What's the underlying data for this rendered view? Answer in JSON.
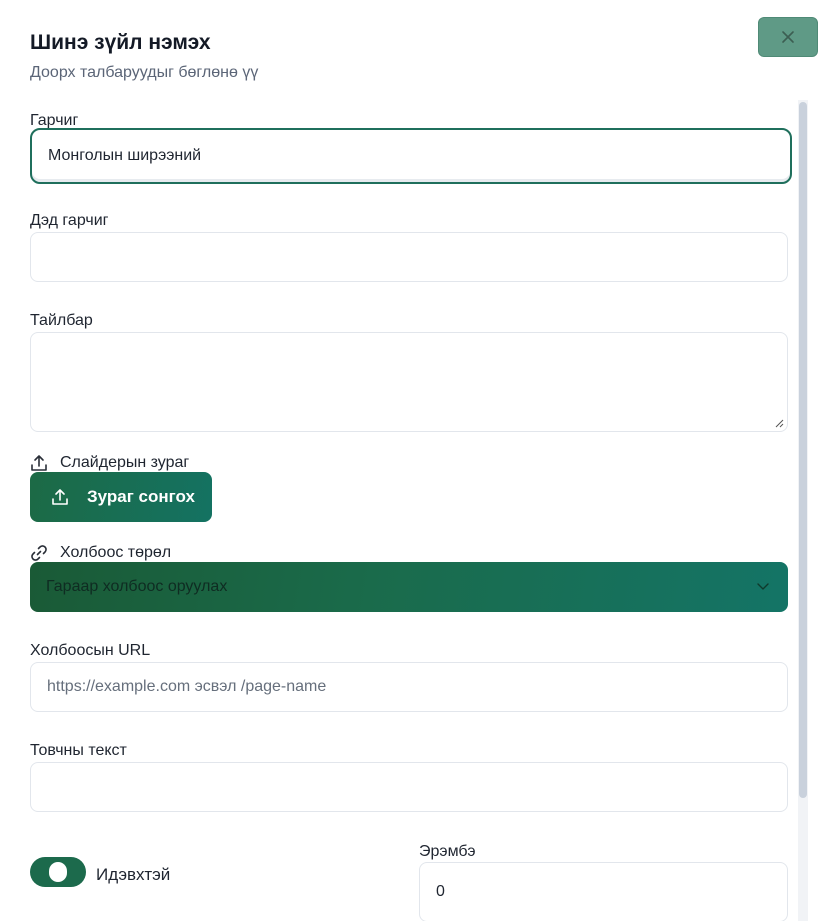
{
  "dialog": {
    "title": "Шинэ зүйл нэмэх",
    "subtitle": "Доорх талбаруудыг бөглөнө үү"
  },
  "fields": {
    "title": {
      "label": "Гарчиг",
      "value": "Монголын ширээний"
    },
    "subtitle": {
      "label": "Дэд гарчиг",
      "value": ""
    },
    "description": {
      "label": "Тайлбар",
      "value": ""
    },
    "slider_image": {
      "label": "Слайдерын зураг",
      "button_label": "Зураг сонгох"
    },
    "link_type": {
      "label": "Холбоос төрөл",
      "selected": "Гараар холбоос оруулах"
    },
    "link_url": {
      "label": "Холбоосын URL",
      "placeholder": "https://example.com эсвэл /page-name"
    },
    "button_text": {
      "label": "Товчны текст",
      "value": ""
    },
    "active": {
      "label": "Идэвхтэй",
      "checked": true
    },
    "order": {
      "label": "Эрэмбэ",
      "value": "0"
    }
  },
  "icons": {
    "close": "close-icon",
    "upload": "upload-icon",
    "link": "link-icon",
    "chevron": "chevron-down-icon"
  },
  "colors": {
    "primary": "#1c6a4c",
    "close_button": "#5f9a86"
  }
}
